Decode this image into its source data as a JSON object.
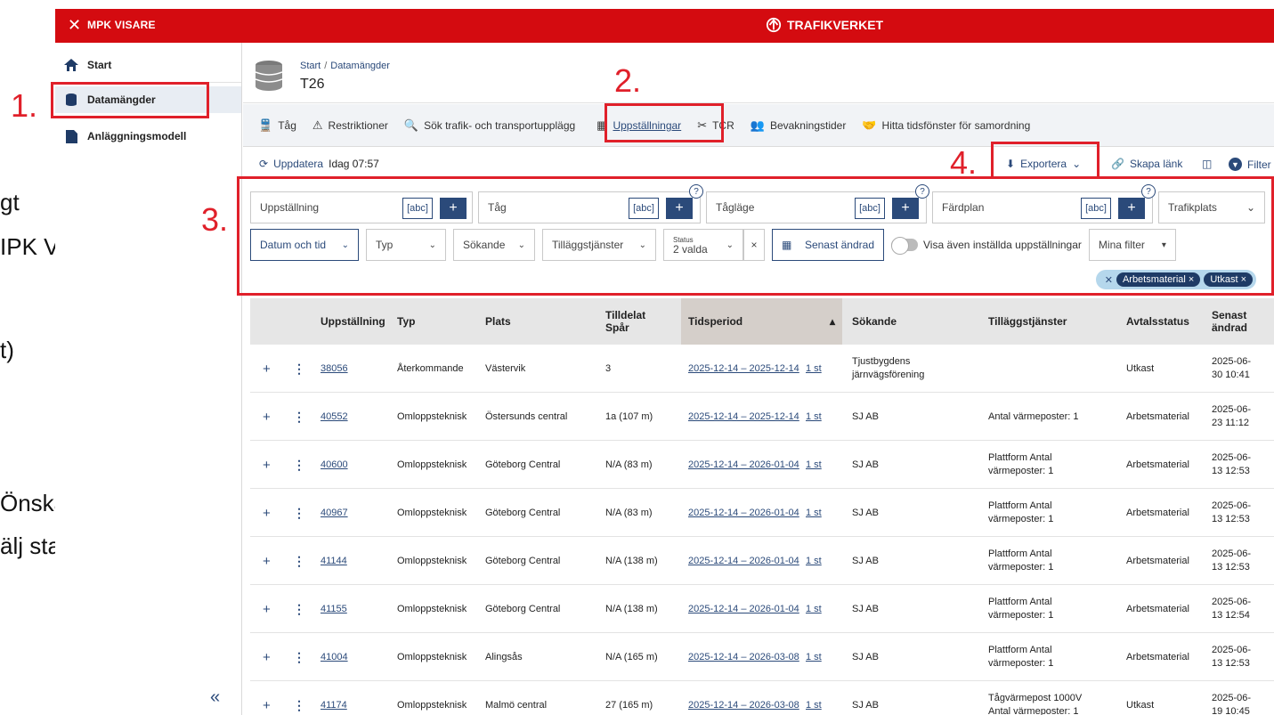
{
  "slide_fragments": [
    "gt",
    "IPK Visare",
    "t)",
    "Önskas",
    "älj status"
  ],
  "annotations": [
    "1.",
    "2.",
    "3.",
    "4."
  ],
  "topbar": {
    "app_name": "MPK VISARE",
    "brand": "TRAFIKVERKET",
    "accent": "#d40b10"
  },
  "sidebar": {
    "items": [
      {
        "label": "Start",
        "icon": "home-icon"
      },
      {
        "label": "Datamängder",
        "icon": "database-icon"
      },
      {
        "label": "Anläggningsmodell",
        "icon": "pdf-icon"
      }
    ],
    "collapse_glyph": "«"
  },
  "header": {
    "breadcrumb": [
      "Start",
      "Datamängder"
    ],
    "title": "T26"
  },
  "tabs": [
    {
      "label": "Tåg",
      "icon": "train-icon"
    },
    {
      "label": "Restriktioner",
      "icon": "restriction-icon"
    },
    {
      "label": "Sök trafik- och transportupplägg",
      "icon": "search-icon"
    },
    {
      "label": "Uppställningar",
      "icon": "calendar-icon"
    },
    {
      "label": "TCR",
      "icon": "tools-icon"
    },
    {
      "label": "Bevakningstider",
      "icon": "people-icon"
    },
    {
      "label": "Hitta tidsfönster för samordning",
      "icon": "handshake-icon"
    }
  ],
  "toolbar": {
    "refresh_label": "Uppdatera",
    "refresh_time": "Idag 07:57",
    "export_label": "Exportera",
    "link_label": "Skapa länk",
    "filter_label": "Filter"
  },
  "filters": {
    "text_fields": [
      {
        "label": "Uppställning",
        "abc": "[abc]"
      },
      {
        "label": "Tåg",
        "abc": "[abc]"
      },
      {
        "label": "Tågläge",
        "abc": "[abc]"
      },
      {
        "label": "Färdplan",
        "abc": "[abc]"
      }
    ],
    "trafikplats": "Trafikplats",
    "datum": "Datum och tid",
    "typ": "Typ",
    "sokande": "Sökande",
    "tillagg": "Tilläggstjänster",
    "status_label": "Status",
    "status_value": "2 valda",
    "senast_andrad": "Senast ändrad",
    "visa_label": "Visa även inställda uppställningar",
    "mina_filter": "Mina filter",
    "chips": [
      "Arbetsmaterial ×",
      "Utkast ×"
    ]
  },
  "table": {
    "columns": [
      "Uppställning",
      "Typ",
      "Plats",
      "Tilldelat Spår",
      "Tidsperiod",
      "Sökande",
      "Tilläggstjänster",
      "Avtalsstatus",
      "Senast ändrad"
    ],
    "rows": [
      {
        "id": "38056",
        "typ": "Återkommande",
        "plats": "Västervik",
        "spar": "3",
        "period": "2025-12-14 – 2025-12-14",
        "count": "1 st",
        "sokande": "Tjustbygdens järnvägsförening",
        "tillagg": "",
        "status": "Utkast",
        "andrad": "2025-06-30 10:41"
      },
      {
        "id": "40552",
        "typ": "Omloppsteknisk",
        "plats": "Östersunds central",
        "spar": "1a (107 m)",
        "period": "2025-12-14 – 2025-12-14",
        "count": "1 st",
        "sokande": "SJ AB",
        "tillagg": "Antal värmeposter: 1",
        "status": "Arbetsmaterial",
        "andrad": "2025-06-23 11:12"
      },
      {
        "id": "40600",
        "typ": "Omloppsteknisk",
        "plats": "Göteborg Central",
        "spar": "N/A (83 m)",
        "period": "2025-12-14 – 2026-01-04",
        "count": "1 st",
        "sokande": "SJ AB",
        "tillagg": "Plattform Antal värmeposter: 1",
        "status": "Arbetsmaterial",
        "andrad": "2025-06-13 12:53"
      },
      {
        "id": "40967",
        "typ": "Omloppsteknisk",
        "plats": "Göteborg Central",
        "spar": "N/A (83 m)",
        "period": "2025-12-14 – 2026-01-04",
        "count": "1 st",
        "sokande": "SJ AB",
        "tillagg": "Plattform Antal värmeposter: 1",
        "status": "Arbetsmaterial",
        "andrad": "2025-06-13 12:53"
      },
      {
        "id": "41144",
        "typ": "Omloppsteknisk",
        "plats": "Göteborg Central",
        "spar": "N/A (138 m)",
        "period": "2025-12-14 – 2026-01-04",
        "count": "1 st",
        "sokande": "SJ AB",
        "tillagg": "Plattform Antal värmeposter: 1",
        "status": "Arbetsmaterial",
        "andrad": "2025-06-13 12:53"
      },
      {
        "id": "41155",
        "typ": "Omloppsteknisk",
        "plats": "Göteborg Central",
        "spar": "N/A (138 m)",
        "period": "2025-12-14 – 2026-01-04",
        "count": "1 st",
        "sokande": "SJ AB",
        "tillagg": "Plattform Antal värmeposter: 1",
        "status": "Arbetsmaterial",
        "andrad": "2025-06-13 12:54"
      },
      {
        "id": "41004",
        "typ": "Omloppsteknisk",
        "plats": "Alingsås",
        "spar": "N/A (165 m)",
        "period": "2025-12-14 – 2026-03-08",
        "count": "1 st",
        "sokande": "SJ AB",
        "tillagg": "Plattform Antal värmeposter: 1",
        "status": "Arbetsmaterial",
        "andrad": "2025-06-13 12:53"
      },
      {
        "id": "41174",
        "typ": "Omloppsteknisk",
        "plats": "Malmö central",
        "spar": "27 (165 m)",
        "period": "2025-12-14 – 2026-03-08",
        "count": "1 st",
        "sokande": "SJ AB",
        "tillagg": "Tågvärmepost 1000V Antal värmeposter: 1",
        "status": "Utkast",
        "andrad": "2025-06-19 10:45"
      }
    ]
  }
}
